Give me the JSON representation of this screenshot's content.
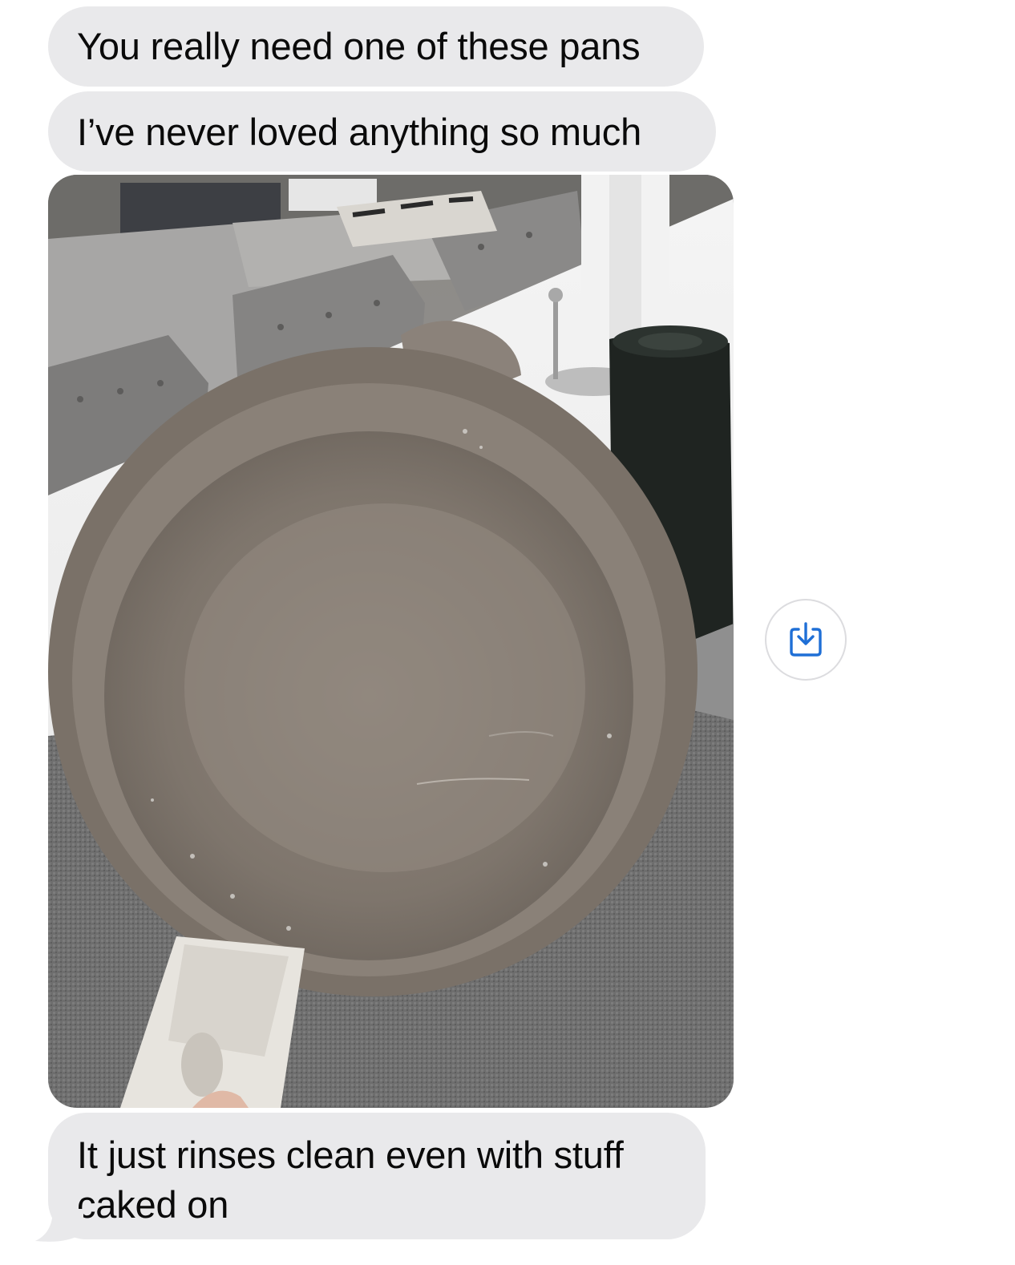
{
  "messages": [
    {
      "text": "You really need one of these pans"
    },
    {
      "text": "I’ve never loved anything so much"
    },
    {
      "text": "It just rinses clean even with stuff caked on"
    }
  ],
  "photo": {
    "icon": "pan-photo"
  },
  "save_button": {
    "icon": "save-download-icon",
    "color": "#1f6fd6"
  },
  "colors": {
    "bubble": "#e9e9eb",
    "text": "#0a0a0a"
  }
}
